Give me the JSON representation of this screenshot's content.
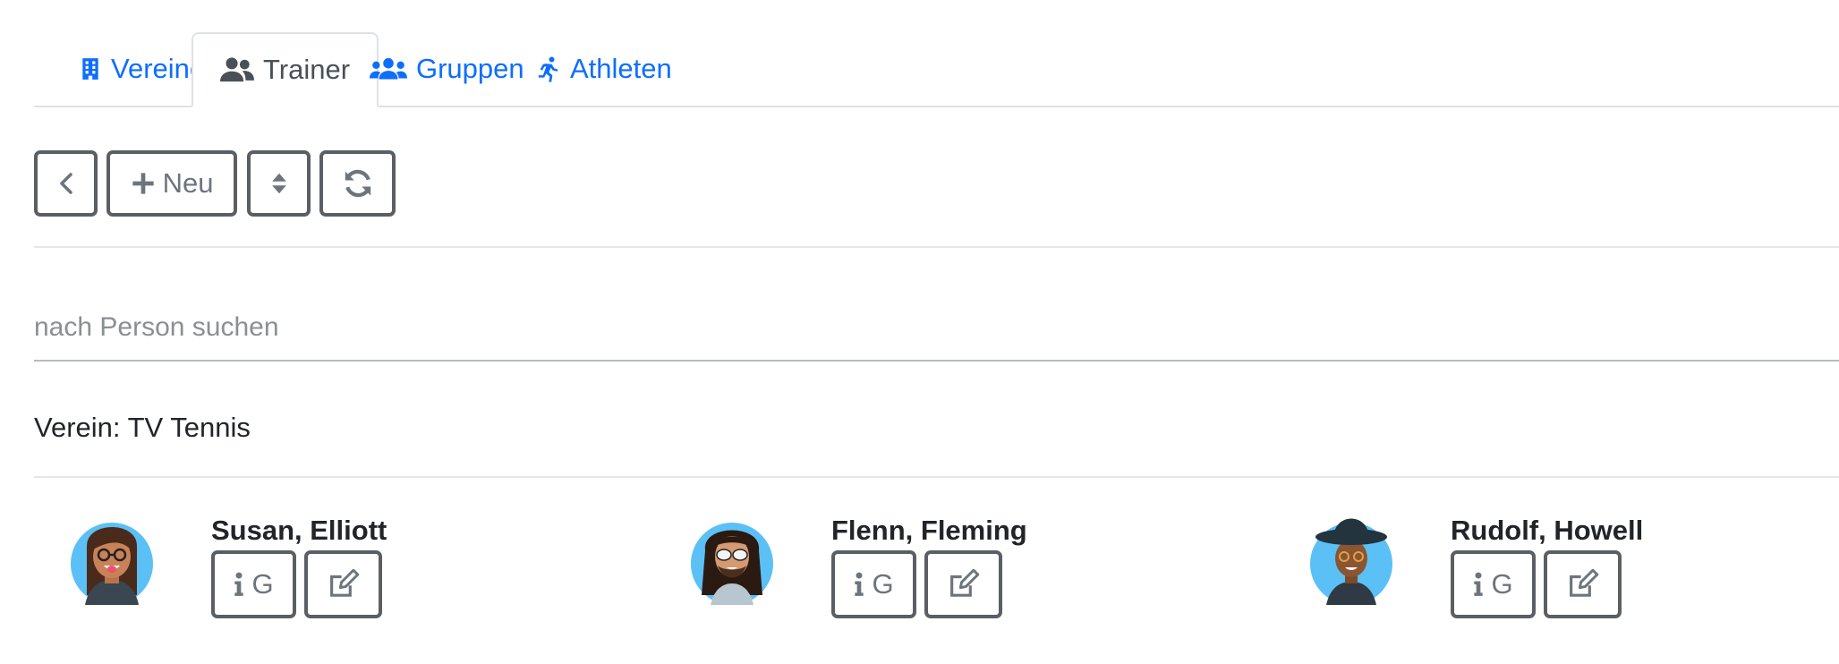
{
  "tabs": [
    {
      "label": "Vereine",
      "icon": "building-icon",
      "active": false
    },
    {
      "label": "Trainer",
      "icon": "user-group-icon",
      "active": true
    },
    {
      "label": "Gruppen",
      "icon": "users-icon",
      "active": false
    },
    {
      "label": "Athleten",
      "icon": "running-icon",
      "active": false
    }
  ],
  "toolbar": {
    "back_icon": "chevron-left-icon",
    "new_label": "Neu",
    "sort_icon": "sort-icon",
    "refresh_icon": "refresh-icon"
  },
  "search": {
    "placeholder": "nach Person suchen",
    "value": ""
  },
  "verein": {
    "label": "Verein: TV Tennis"
  },
  "persons": [
    {
      "name": "Susan, Elliott",
      "info_letter": "G",
      "avatar": "avatar-woman-glasses"
    },
    {
      "name": "Flenn, Fleming",
      "info_letter": "G",
      "avatar": "avatar-man-sunglasses-dreadlocks"
    },
    {
      "name": "Rudolf, Howell",
      "info_letter": "G",
      "avatar": "avatar-man-hat-glasses"
    }
  ],
  "colors": {
    "link": "#0d6efd",
    "active_tab": "#495057",
    "button_border": "#5a5f65",
    "button_text": "#6c757d",
    "avatar_bg": "#5bc0f5"
  }
}
